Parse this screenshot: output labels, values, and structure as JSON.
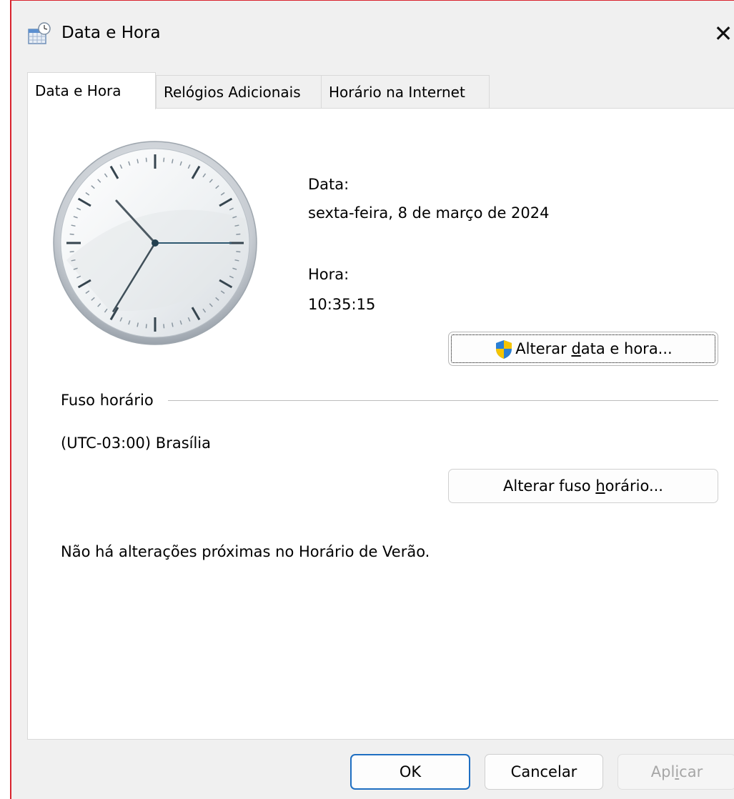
{
  "window": {
    "title": "Data e Hora",
    "close_glyph": "✕"
  },
  "tabs": [
    {
      "label": "Data e Hora",
      "active": true
    },
    {
      "label": "Relógios Adicionais",
      "active": false
    },
    {
      "label": "Horário na Internet",
      "active": false
    }
  ],
  "date_section": {
    "date_label": "Data:",
    "date_value": "sexta-feira, 8 de março de 2024",
    "time_label": "Hora:",
    "time_value": "10:35:15",
    "change_button": {
      "before": "Alterar ",
      "accel": "d",
      "after": "ata e hora..."
    }
  },
  "clock": {
    "hours": 10,
    "minutes": 35,
    "seconds": 15
  },
  "timezone": {
    "group_label": "Fuso horário",
    "value": "(UTC-03:00) Brasília",
    "change_button": {
      "before": "Alterar fuso ",
      "accel": "h",
      "after": "orário..."
    }
  },
  "dst_note": "Não há alterações próximas no Horário de Verão.",
  "footer": {
    "ok": "OK",
    "cancel": "Cancelar",
    "apply_before": "Apl",
    "apply_accel": "i",
    "apply_after": "car"
  },
  "colors": {
    "shield_blue": "#2a7fd4",
    "shield_yellow": "#f5c400",
    "focus_blue": "#1f6fc2"
  },
  "icons": {
    "title_icon": "calendar-clock-icon",
    "close": "close-icon",
    "uac": "uac-shield-icon"
  }
}
